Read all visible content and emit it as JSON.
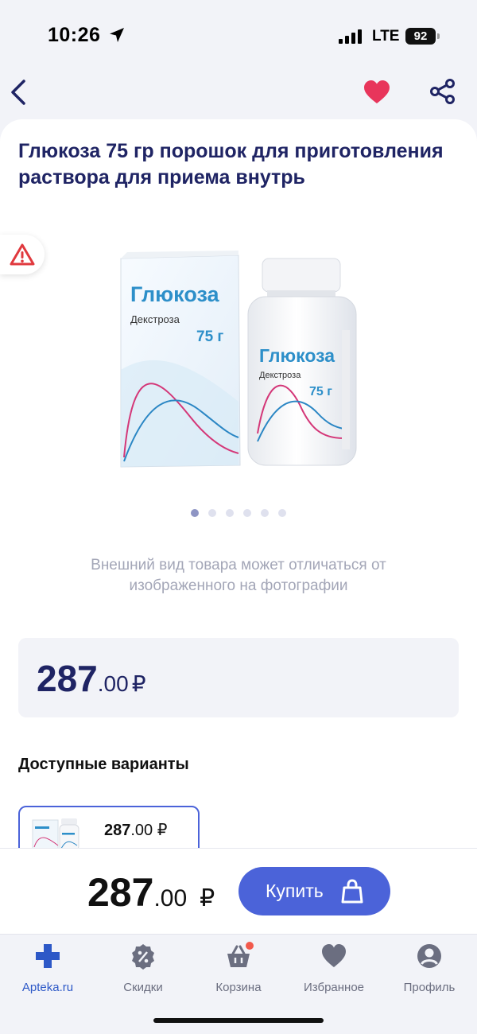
{
  "status_bar": {
    "time": "10:26",
    "network": "LTE",
    "battery": "92"
  },
  "header": {
    "back_icon": "chevron-left-icon",
    "favorite_icon": "heart-icon",
    "share_icon": "share-icon"
  },
  "product": {
    "title": "Глюкоза 75 гр порошок для приготовления раствора для приема внутрь",
    "image_texts": {
      "box_brand": "Глюкоза",
      "box_subtitle": "Декстроза",
      "box_weight": "75 г",
      "bottle_brand": "Глюкоза",
      "bottle_subtitle": "Декстроза",
      "bottle_weight": "75 г"
    },
    "gallery_total": 6,
    "gallery_active": 1,
    "disclaimer": "Внешний вид товара может отличаться от изображенного на фотографии",
    "price": {
      "rubles": "287",
      "kopecks": ".00",
      "currency": "₽"
    }
  },
  "variants": {
    "title": "Доступные варианты",
    "items": [
      {
        "rubles": "287",
        "kopecks": ".00",
        "currency": "₽"
      }
    ]
  },
  "buy_bar": {
    "rubles": "287",
    "kopecks": ".00",
    "currency": "₽",
    "button_label": "Купить"
  },
  "tab_bar": {
    "items": [
      {
        "label": "Apteka.ru",
        "icon": "plus-cross-icon",
        "active": true
      },
      {
        "label": "Скидки",
        "icon": "discount-badge-icon",
        "active": false
      },
      {
        "label": "Корзина",
        "icon": "basket-icon",
        "active": false,
        "badge": true
      },
      {
        "label": "Избранное",
        "icon": "heart-icon",
        "active": false
      },
      {
        "label": "Профиль",
        "icon": "profile-icon",
        "active": false
      }
    ]
  },
  "colors": {
    "accent": "#4b63d9",
    "title": "#1f2464",
    "favorite": "#e8355b",
    "badge": "#f2594c"
  }
}
